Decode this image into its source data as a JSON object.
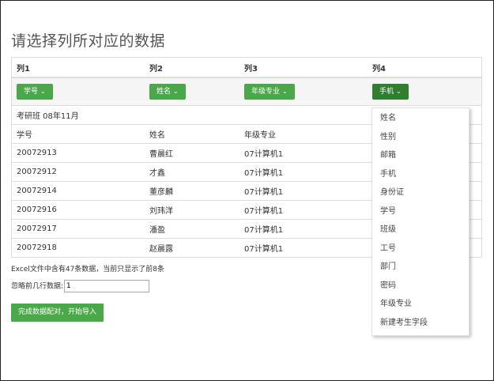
{
  "page": {
    "title": "请选择列所对应的数据"
  },
  "columns": [
    "列1",
    "列2",
    "列3",
    "列4"
  ],
  "buttons": [
    "学号",
    "姓名",
    "年级专业",
    "手机"
  ],
  "table": {
    "group_row": "考研班 08年11月",
    "header_row": [
      "学号",
      "姓名",
      "年级专业",
      ""
    ],
    "rows": [
      [
        "20072913",
        "曹晨红",
        "07计算机1",
        ""
      ],
      [
        "20072912",
        "才鑫",
        "07计算机1",
        ""
      ],
      [
        "20072914",
        "董彦麟",
        "07计算机1",
        ""
      ],
      [
        "20072916",
        "刘玮洋",
        "07计算机1",
        ""
      ],
      [
        "20072917",
        "潘盈",
        "07计算机1",
        ""
      ],
      [
        "20072918",
        "赵晨露",
        "07计算机1",
        ""
      ]
    ]
  },
  "info_text": "Excel文件中含有47条数据，当前只显示了前8条",
  "skip": {
    "label": "忽略前几行数据:",
    "value": "1"
  },
  "submit_label": "完成数据配对，开始导入",
  "dropdown": {
    "options": [
      "姓名",
      "性别",
      "邮箱",
      "手机",
      "身份证",
      "学号",
      "班级",
      "工号",
      "部门",
      "密码",
      "年级专业",
      "新建考生字段"
    ]
  },
  "colors": {
    "button_green": "#4aa84a",
    "button_active": "#2f7f2f"
  },
  "icons": {
    "caret": "chevron-down-icon"
  }
}
